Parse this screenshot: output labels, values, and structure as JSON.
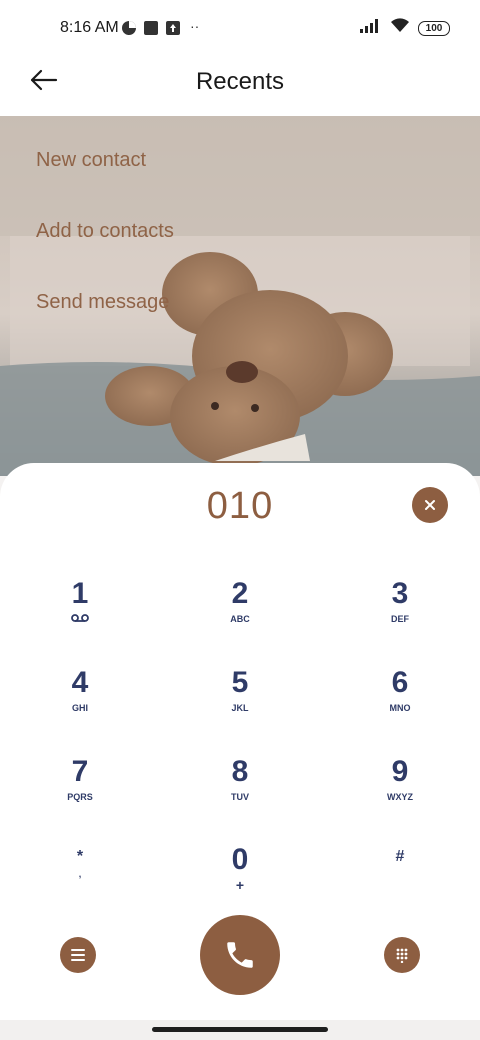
{
  "status_bar": {
    "time": "8:16 AM",
    "battery": "100"
  },
  "header": {
    "title": "Recents"
  },
  "menu": {
    "items": [
      "New contact",
      "Add to contacts",
      "Send message"
    ]
  },
  "dialer": {
    "number": "010",
    "keys": [
      {
        "digit": "1",
        "sub": ""
      },
      {
        "digit": "2",
        "sub": "ABC"
      },
      {
        "digit": "3",
        "sub": "DEF"
      },
      {
        "digit": "4",
        "sub": "GHI"
      },
      {
        "digit": "5",
        "sub": "JKL"
      },
      {
        "digit": "6",
        "sub": "MNO"
      },
      {
        "digit": "7",
        "sub": "PQRS"
      },
      {
        "digit": "8",
        "sub": "TUV"
      },
      {
        "digit": "9",
        "sub": "WXYZ"
      },
      {
        "digit": "*",
        "sub": ","
      },
      {
        "digit": "0",
        "sub": "+"
      },
      {
        "digit": "#",
        "sub": ""
      }
    ]
  },
  "colors": {
    "accent": "#8d5e41",
    "key_text": "#2f3b67",
    "menu_text": "#8f6347"
  },
  "icons": {
    "back": "arrow-left-icon",
    "clear": "close-icon",
    "voicemail": "voicemail-icon",
    "menu": "menu-icon",
    "call": "phone-icon",
    "keypad": "dialpad-icon"
  }
}
